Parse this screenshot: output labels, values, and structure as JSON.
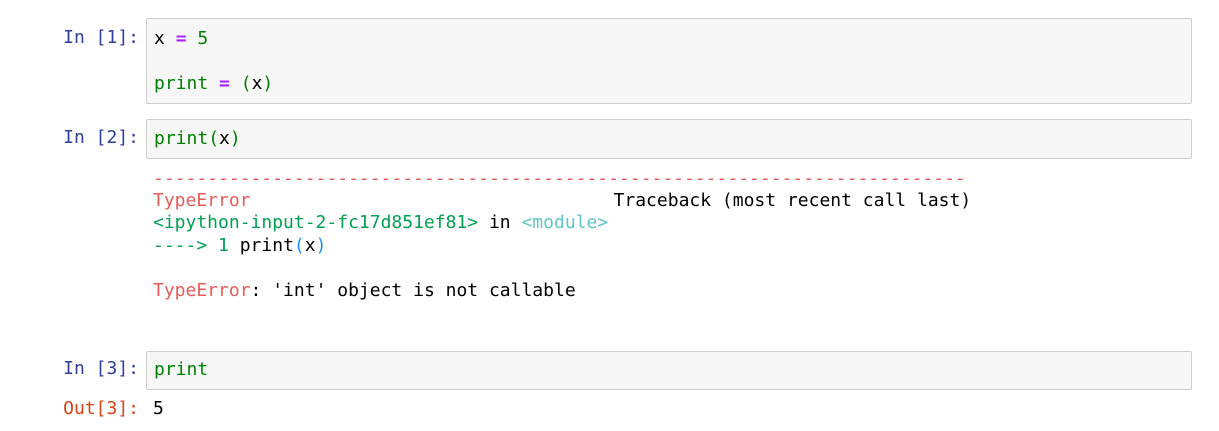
{
  "cells": [
    {
      "prompt": "In [1]:",
      "lines": [
        {
          "var": "x",
          "op": "=",
          "num": "5"
        },
        {
          "name": "print",
          "op": "=",
          "open": "(",
          "arg": "x",
          "close": ")"
        }
      ]
    },
    {
      "prompt": "In [2]:",
      "code": {
        "name": "print",
        "open": "(",
        "arg": "x",
        "close": ")"
      },
      "error": {
        "dash_line": "---------------------------------------------------------------------------",
        "exc_type": "TypeError",
        "traceback_label": "Traceback (most recent call last)",
        "input_ref": "<ipython-input-2-fc17d851ef81>",
        "in_word": " in ",
        "module": "<module>",
        "arrow": "---->",
        "line_no": "1",
        "line_code": "print",
        "line_open": "(",
        "line_arg": "x",
        "line_close": ")",
        "final_type": "TypeError",
        "final_msg": ": 'int' object is not callable"
      }
    },
    {
      "prompt": "In [3]:",
      "code": "print",
      "out_prompt": "Out[3]:",
      "out_value": "5"
    }
  ],
  "colors": {
    "in_prompt": "#303f9f",
    "out_prompt": "#d84315",
    "keyword": "#008000",
    "operator": "#aa22ff",
    "error_red": "#e75c58",
    "error_green": "#00a250",
    "error_cyan": "#60c6c8",
    "error_blue": "#208ffb"
  }
}
